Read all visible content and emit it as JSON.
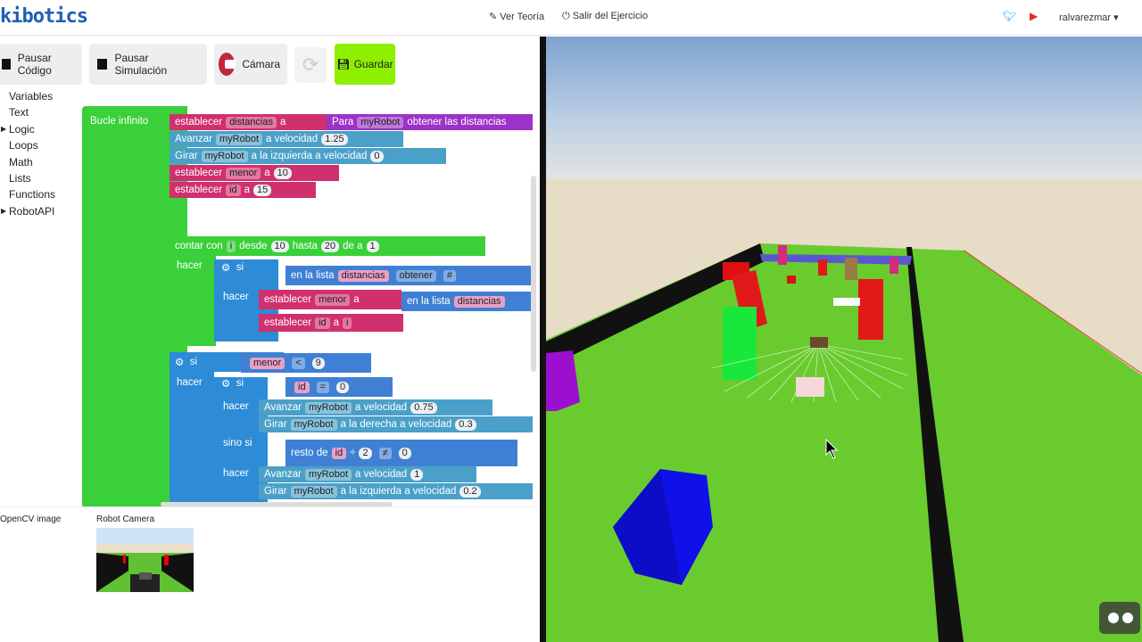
{
  "header": {
    "logo": "kibotics",
    "theory_link": "Ver Teoría",
    "exit_link": "Salir del Ejercicio",
    "user": "ralvarezmar"
  },
  "toolbar": {
    "pause_code": "Pausar Código",
    "pause_sim": "Pausar Simulación",
    "camera": "Cámara",
    "save": "Guardar"
  },
  "categories": [
    "Variables",
    "Text",
    "Logic",
    "Loops",
    "Math",
    "Lists",
    "Functions",
    "RobotAPI"
  ],
  "blocks": {
    "loop": "Bucle infinito",
    "set1": "establecer",
    "var_dist": "distancias",
    "a": "a",
    "para": "Para",
    "robot": "myRobot",
    "get_dist": "obtener las distancias",
    "advance": "Avanzar",
    "speed": "a velocidad",
    "v125": "1.25",
    "turn": "Girar",
    "left_speed": "a la izquierda a velocidad",
    "v0": "0",
    "var_menor": "menor",
    "v10": "10",
    "var_id": "id",
    "v15": "15",
    "count": "contar con",
    "var_i": "i",
    "desde": "desde",
    "hasta": "hasta",
    "v20": "20",
    "de_a": "de a",
    "v1": "1",
    "hacer": "hacer",
    "si": "si",
    "in_list": "en la lista",
    "get": "obtener",
    "hash": "#",
    "lt": "<",
    "v9": "9",
    "eq": "=",
    "v075": "0.75",
    "right_speed": "a la derecha a velocidad",
    "v03": "0.3",
    "sino_si": "sino si",
    "resto": "resto de",
    "div": "÷",
    "v2": "2",
    "neq": "≠",
    "v02": "0.2"
  },
  "bottom": {
    "opencv": "OpenCV image",
    "robot_camera": "Robot Camera"
  }
}
